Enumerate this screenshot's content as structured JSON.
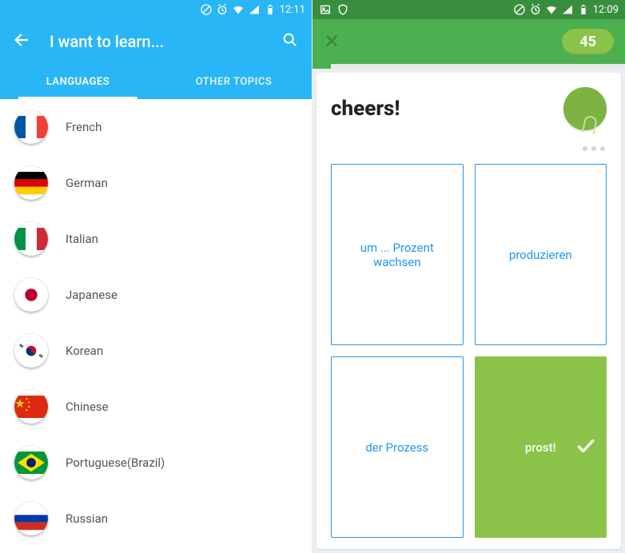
{
  "left": {
    "status": {
      "time": "12:11"
    },
    "toolbar": {
      "title": "I want to learn..."
    },
    "tabs": [
      {
        "label": "LANGUAGES",
        "active": true
      },
      {
        "label": "OTHER TOPICS",
        "active": false
      }
    ],
    "languages": [
      {
        "name": "French"
      },
      {
        "name": "German"
      },
      {
        "name": "Italian"
      },
      {
        "name": "Japanese"
      },
      {
        "name": "Korean"
      },
      {
        "name": "Chinese"
      },
      {
        "name": "Portuguese(Brazil)"
      },
      {
        "name": "Russian"
      }
    ]
  },
  "right": {
    "status": {
      "time": "12:09"
    },
    "score": "45",
    "progress_percent": 6,
    "prompt": "cheers!",
    "answers": [
      {
        "text": "um ... Prozent wachsen",
        "correct": false
      },
      {
        "text": "produzieren",
        "correct": false
      },
      {
        "text": "der Prozess",
        "correct": false
      },
      {
        "text": "prost!",
        "correct": true
      }
    ]
  }
}
